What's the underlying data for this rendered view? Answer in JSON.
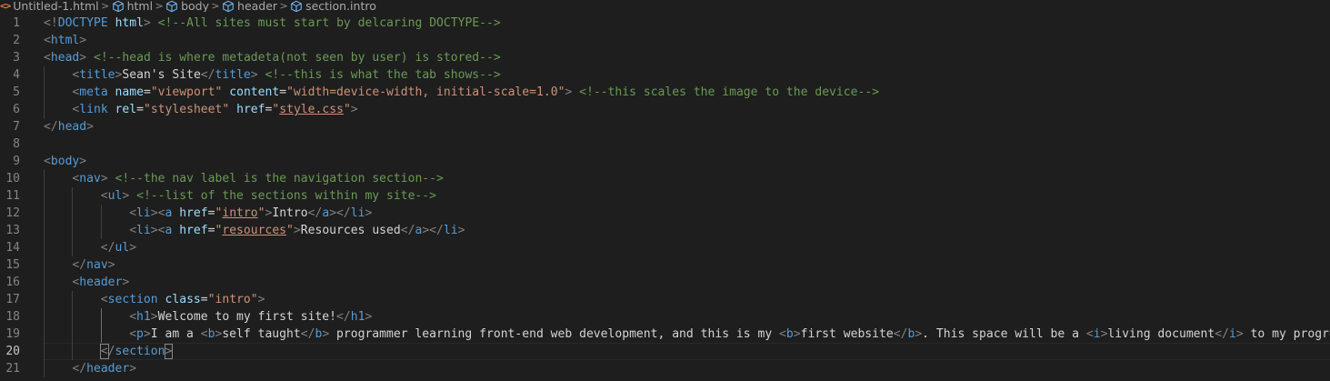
{
  "breadcrumb": {
    "items": [
      {
        "label": "Untitled-1.html",
        "icon": "html-file-icon"
      },
      {
        "label": "html",
        "icon": "element-cube-icon"
      },
      {
        "label": "body",
        "icon": "element-cube-icon"
      },
      {
        "label": "header",
        "icon": "element-cube-icon"
      },
      {
        "label": "section.intro",
        "icon": "element-cube-icon"
      }
    ],
    "separator": ">",
    "file_icon_glyph": "<>"
  },
  "editor": {
    "current_line": 20,
    "colors": {
      "background": "#1e1e1e",
      "tag": "#569cd6",
      "bracket": "#808080",
      "attribute": "#9cdcfe",
      "string": "#ce9178",
      "comment": "#6a9955",
      "text": "#d4d4d4",
      "line_number": "#858585"
    },
    "lines": [
      {
        "n": "1",
        "indent": 0,
        "tokens": [
          [
            "b",
            "<!"
          ],
          [
            "t",
            "DOCTYPE"
          ],
          [
            "x",
            " "
          ],
          [
            "a",
            "html"
          ],
          [
            "b",
            ">"
          ],
          [
            "x",
            " "
          ],
          [
            "c",
            "<!--All sites must start by delcaring DOCTYPE-->"
          ]
        ]
      },
      {
        "n": "2",
        "indent": 0,
        "tokens": [
          [
            "b",
            "<"
          ],
          [
            "t",
            "html"
          ],
          [
            "b",
            ">"
          ]
        ]
      },
      {
        "n": "3",
        "indent": 0,
        "tokens": [
          [
            "b",
            "<"
          ],
          [
            "t",
            "head"
          ],
          [
            "b",
            ">"
          ],
          [
            "x",
            " "
          ],
          [
            "c",
            "<!--head is where metadeta(not seen by user) is stored-->"
          ]
        ]
      },
      {
        "n": "4",
        "indent": 1,
        "tokens": [
          [
            "b",
            "<"
          ],
          [
            "t",
            "title"
          ],
          [
            "b",
            ">"
          ],
          [
            "x",
            "Sean's Site"
          ],
          [
            "b",
            "</"
          ],
          [
            "t",
            "title"
          ],
          [
            "b",
            ">"
          ],
          [
            "x",
            " "
          ],
          [
            "c",
            "<!--this is what the tab shows-->"
          ]
        ]
      },
      {
        "n": "5",
        "indent": 1,
        "tokens": [
          [
            "b",
            "<"
          ],
          [
            "t",
            "meta"
          ],
          [
            "x",
            " "
          ],
          [
            "a",
            "name"
          ],
          [
            "x",
            "="
          ],
          [
            "s",
            "\"viewport\""
          ],
          [
            "x",
            " "
          ],
          [
            "a",
            "content"
          ],
          [
            "x",
            "="
          ],
          [
            "s",
            "\"width=device-width, initial-scale=1.0\""
          ],
          [
            "b",
            ">"
          ],
          [
            "x",
            " "
          ],
          [
            "c",
            "<!--this scales the image to the device-->"
          ]
        ]
      },
      {
        "n": "6",
        "indent": 1,
        "tokens": [
          [
            "b",
            "<"
          ],
          [
            "t",
            "link"
          ],
          [
            "x",
            " "
          ],
          [
            "a",
            "rel"
          ],
          [
            "x",
            "="
          ],
          [
            "s",
            "\"stylesheet\""
          ],
          [
            "x",
            " "
          ],
          [
            "a",
            "href"
          ],
          [
            "x",
            "="
          ],
          [
            "s",
            "\""
          ],
          [
            "sl",
            "style.css"
          ],
          [
            "s",
            "\""
          ],
          [
            "b",
            ">"
          ]
        ]
      },
      {
        "n": "7",
        "indent": 0,
        "tokens": [
          [
            "b",
            "</"
          ],
          [
            "t",
            "head"
          ],
          [
            "b",
            ">"
          ]
        ]
      },
      {
        "n": "8",
        "indent": 0,
        "tokens": []
      },
      {
        "n": "9",
        "indent": 0,
        "tokens": [
          [
            "b",
            "<"
          ],
          [
            "t",
            "body"
          ],
          [
            "b",
            ">"
          ]
        ]
      },
      {
        "n": "10",
        "indent": 1,
        "tokens": [
          [
            "b",
            "<"
          ],
          [
            "t",
            "nav"
          ],
          [
            "b",
            ">"
          ],
          [
            "x",
            " "
          ],
          [
            "c",
            "<!--the nav label is the navigation section-->"
          ]
        ]
      },
      {
        "n": "11",
        "indent": 2,
        "tokens": [
          [
            "b",
            "<"
          ],
          [
            "t",
            "ul"
          ],
          [
            "b",
            ">"
          ],
          [
            "x",
            " "
          ],
          [
            "c",
            "<!--list of the sections within my site-->"
          ]
        ]
      },
      {
        "n": "12",
        "indent": 3,
        "tokens": [
          [
            "b",
            "<"
          ],
          [
            "t",
            "li"
          ],
          [
            "b",
            "><"
          ],
          [
            "t",
            "a"
          ],
          [
            "x",
            " "
          ],
          [
            "a",
            "href"
          ],
          [
            "x",
            "="
          ],
          [
            "s",
            "\""
          ],
          [
            "sl",
            "intro"
          ],
          [
            "s",
            "\""
          ],
          [
            "b",
            ">"
          ],
          [
            "x",
            "Intro"
          ],
          [
            "b",
            "</"
          ],
          [
            "t",
            "a"
          ],
          [
            "b",
            "></"
          ],
          [
            "t",
            "li"
          ],
          [
            "b",
            ">"
          ]
        ]
      },
      {
        "n": "13",
        "indent": 3,
        "tokens": [
          [
            "b",
            "<"
          ],
          [
            "t",
            "li"
          ],
          [
            "b",
            "><"
          ],
          [
            "t",
            "a"
          ],
          [
            "x",
            " "
          ],
          [
            "a",
            "href"
          ],
          [
            "x",
            "="
          ],
          [
            "s",
            "\""
          ],
          [
            "sl",
            "resources"
          ],
          [
            "s",
            "\""
          ],
          [
            "b",
            ">"
          ],
          [
            "x",
            "Resources used"
          ],
          [
            "b",
            "</"
          ],
          [
            "t",
            "a"
          ],
          [
            "b",
            "></"
          ],
          [
            "t",
            "li"
          ],
          [
            "b",
            ">"
          ]
        ]
      },
      {
        "n": "14",
        "indent": 2,
        "tokens": [
          [
            "b",
            "</"
          ],
          [
            "t",
            "ul"
          ],
          [
            "b",
            ">"
          ]
        ]
      },
      {
        "n": "15",
        "indent": 1,
        "tokens": [
          [
            "b",
            "</"
          ],
          [
            "t",
            "nav"
          ],
          [
            "b",
            ">"
          ]
        ]
      },
      {
        "n": "16",
        "indent": 1,
        "tokens": [
          [
            "b",
            "<"
          ],
          [
            "t",
            "header"
          ],
          [
            "b",
            ">"
          ]
        ]
      },
      {
        "n": "17",
        "indent": 2,
        "tokens": [
          [
            "b",
            "<"
          ],
          [
            "t",
            "section"
          ],
          [
            "x",
            " "
          ],
          [
            "a",
            "class"
          ],
          [
            "x",
            "="
          ],
          [
            "s",
            "\"intro\""
          ],
          [
            "b",
            ">"
          ]
        ]
      },
      {
        "n": "18",
        "indent": 3,
        "tokens": [
          [
            "b",
            "<"
          ],
          [
            "t",
            "h1"
          ],
          [
            "b",
            ">"
          ],
          [
            "x",
            "Welcome to my first site!"
          ],
          [
            "b",
            "</"
          ],
          [
            "t",
            "h1"
          ],
          [
            "b",
            ">"
          ]
        ]
      },
      {
        "n": "19",
        "indent": 3,
        "tokens": [
          [
            "b",
            "<"
          ],
          [
            "t",
            "p"
          ],
          [
            "b",
            ">"
          ],
          [
            "x",
            "I am a "
          ],
          [
            "b",
            "<"
          ],
          [
            "t",
            "b"
          ],
          [
            "b",
            ">"
          ],
          [
            "x",
            "self taught"
          ],
          [
            "b",
            "</"
          ],
          [
            "t",
            "b"
          ],
          [
            "b",
            ">"
          ],
          [
            "x",
            " programmer learning front-end web development, and this is my "
          ],
          [
            "b",
            "<"
          ],
          [
            "t",
            "b"
          ],
          [
            "b",
            ">"
          ],
          [
            "x",
            "first website"
          ],
          [
            "b",
            "</"
          ],
          [
            "t",
            "b"
          ],
          [
            "b",
            ">"
          ],
          [
            "x",
            ". This space will be a "
          ],
          [
            "b",
            "<"
          ],
          [
            "t",
            "i"
          ],
          [
            "b",
            ">"
          ],
          [
            "x",
            "living document"
          ],
          [
            "b",
            "</"
          ],
          [
            "t",
            "i"
          ],
          [
            "b",
            ">"
          ],
          [
            "x",
            " to my progress,"
          ]
        ]
      },
      {
        "n": "20",
        "indent": 2,
        "tokens": [
          [
            "bm",
            "<"
          ],
          [
            "b",
            "/"
          ],
          [
            "t",
            "section"
          ],
          [
            "bm",
            ">"
          ],
          [
            "cur",
            ""
          ]
        ]
      },
      {
        "n": "21",
        "indent": 1,
        "tokens": [
          [
            "b",
            "</"
          ],
          [
            "t",
            "header"
          ],
          [
            "b",
            ">"
          ]
        ]
      }
    ]
  }
}
